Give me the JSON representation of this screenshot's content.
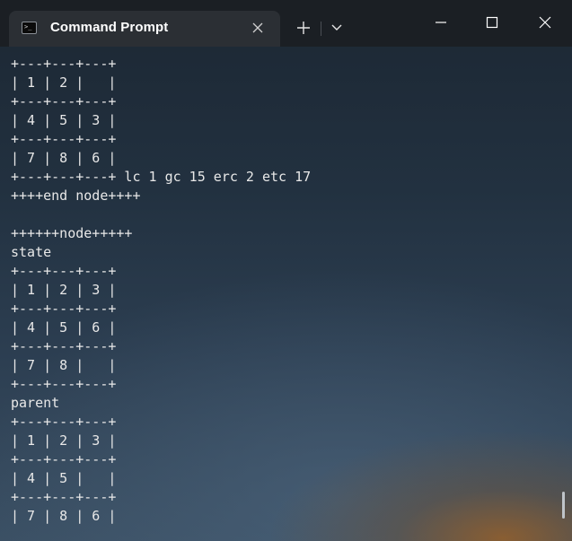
{
  "window": {
    "tab_title": "Command Prompt",
    "tab_icon_glyph": ">_",
    "close_tab_glyph": "✕",
    "new_tab_glyph": "+",
    "dropdown_glyph": "⌄",
    "minimize_glyph": "—",
    "maximize_glyph": "☐",
    "close_window_glyph": "✕"
  },
  "icons": {
    "tab_icon": "terminal-icon",
    "close_tab": "close-icon",
    "new_tab": "plus-icon",
    "dropdown": "chevron-down-icon",
    "minimize": "minimize-icon",
    "maximize": "maximize-icon",
    "close_window": "close-icon"
  },
  "terminal": {
    "lines": [
      "+---+---+---+",
      "| 1 | 2 |   |",
      "+---+---+---+",
      "| 4 | 5 | 3 |",
      "+---+---+---+",
      "| 7 | 8 | 6 |",
      "+---+---+---+ lc 1 gc 15 erc 2 etc 17",
      "++++end node++++",
      "",
      "++++++node+++++",
      "state",
      "+---+---+---+",
      "| 1 | 2 | 3 |",
      "+---+---+---+",
      "| 4 | 5 | 6 |",
      "+---+---+---+",
      "| 7 | 8 |   |",
      "+---+---+---+",
      "parent",
      "+---+---+---+",
      "| 1 | 2 | 3 |",
      "+---+---+---+",
      "| 4 | 5 |   |",
      "+---+---+---+",
      "| 7 | 8 | 6 |"
    ]
  }
}
